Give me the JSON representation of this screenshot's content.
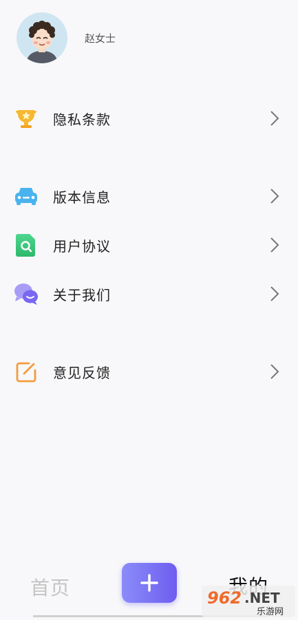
{
  "profile": {
    "username": "赵女士"
  },
  "menu": [
    {
      "label": "隐私条款",
      "icon": "trophy-icon"
    },
    {
      "label": "版本信息",
      "icon": "car-icon"
    },
    {
      "label": "用户协议",
      "icon": "document-search-icon"
    },
    {
      "label": "关于我们",
      "icon": "chat-bubbles-icon"
    },
    {
      "label": "意见反馈",
      "icon": "edit-square-icon"
    }
  ],
  "tabbar": {
    "home_label": "首页",
    "add_icon": "plus-icon",
    "mine_label": "我的"
  },
  "watermark": {
    "brand": "962.NET",
    "sub": "乐游网"
  },
  "colors": {
    "accent_start": "#8a8cf9",
    "accent_end": "#6f5df0",
    "trophy": "#f5b82e",
    "car": "#4ab3ef",
    "document": "#39c77c",
    "chat": "#8d7ff5",
    "edit": "#f39c3c"
  }
}
